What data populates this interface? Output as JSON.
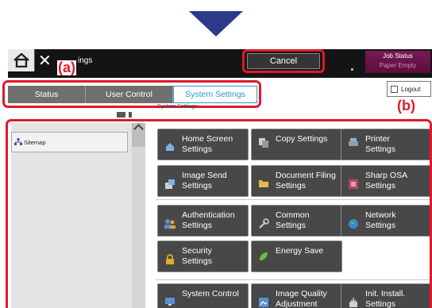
{
  "top": {
    "title": "ings",
    "cancel_label": "Cancel",
    "job_status_title": "Job Status",
    "job_status_sub": "Paper Empty"
  },
  "callouts": {
    "a": "(a)",
    "b": "(b)"
  },
  "tabs": [
    {
      "label": "Status",
      "active": false
    },
    {
      "label": "User Control",
      "active": false
    },
    {
      "label": "System Settings",
      "active": true
    }
  ],
  "logout_label": "Logout",
  "breadcrumb": "System Settings",
  "sidebar": {
    "item_label": "Sitemap"
  },
  "tiles": [
    {
      "label_1": "Home Screen",
      "label_2": "Settings",
      "icon": "home-icon"
    },
    {
      "label_1": "Copy Settings",
      "label_2": "",
      "icon": "copy-icon"
    },
    {
      "label_1": "Printer",
      "label_2": "Settings",
      "icon": "printer-icon"
    },
    {
      "label_1": "Image Send",
      "label_2": "Settings",
      "icon": "image-send-icon"
    },
    {
      "label_1": "Document Filing",
      "label_2": "Settings",
      "icon": "folder-icon"
    },
    {
      "label_1": "Sharp OSA",
      "label_2": "Settings",
      "icon": "osa-icon"
    },
    {
      "label_1": "Authentication",
      "label_2": "Settings",
      "icon": "users-icon"
    },
    {
      "label_1": "Common",
      "label_2": "Settings",
      "icon": "common-settings-icon"
    },
    {
      "label_1": "Network",
      "label_2": "Settings",
      "icon": "network-globe-icon"
    },
    {
      "label_1": "Security",
      "label_2": "Settings",
      "icon": "lock-icon"
    },
    {
      "label_1": "Energy Save",
      "label_2": "",
      "icon": "leaf-icon"
    },
    {
      "label_1": "System Control",
      "label_2": "",
      "icon": "monitor-icon"
    },
    {
      "label_1": "Image Quality",
      "label_2": "Adjustment",
      "icon": "image-quality-icon"
    },
    {
      "label_1": "Init. Install.",
      "label_2": "Settings",
      "icon": "install-icon"
    }
  ],
  "colors": {
    "callout_red": "#e0182c",
    "active_tab_blue": "#2a96d6",
    "arrow_navy": "#2c3a8c",
    "job_status_bg": "#7b1a55"
  }
}
